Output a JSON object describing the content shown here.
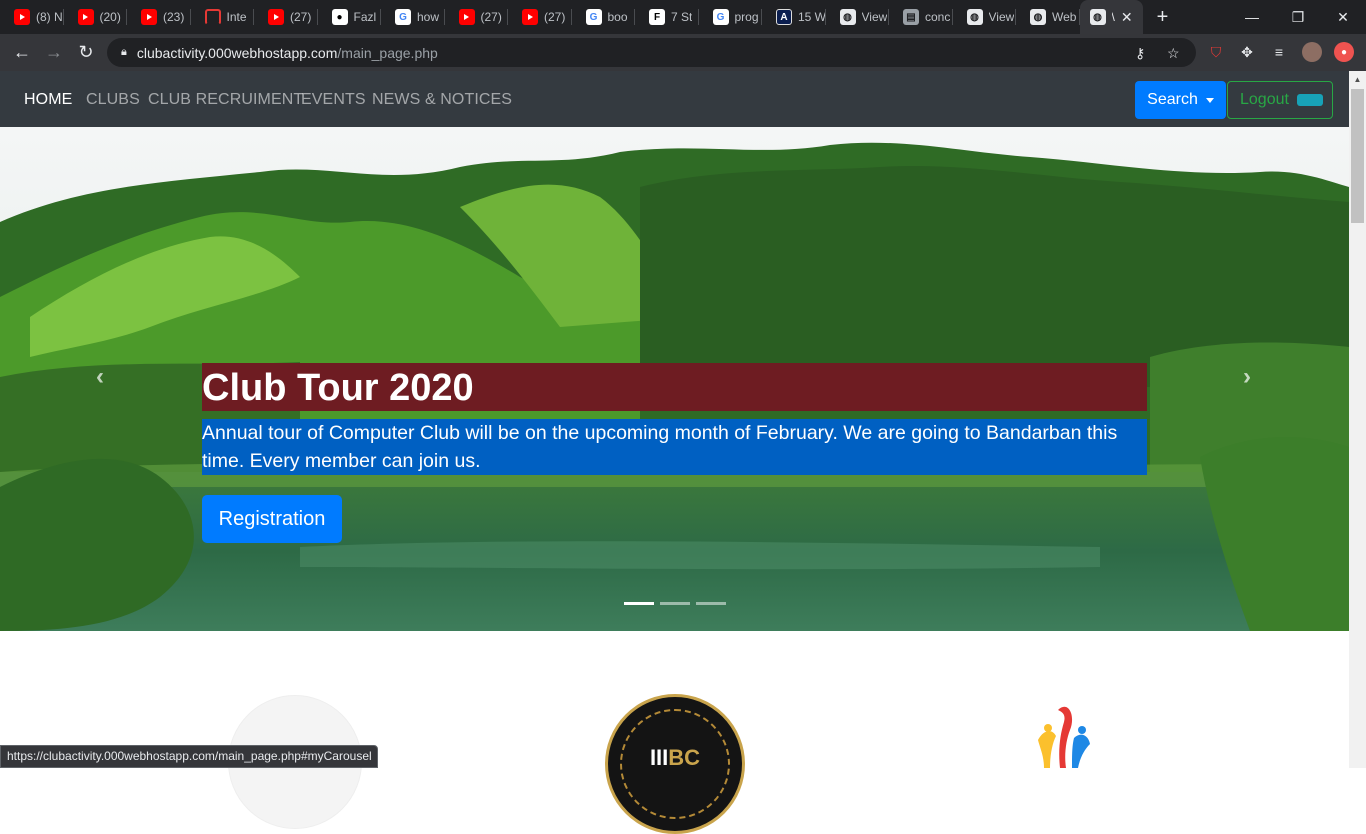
{
  "browser": {
    "tabs": [
      {
        "icon": "youtube-icon",
        "title": "(8) N"
      },
      {
        "icon": "youtube-icon",
        "title": "(20)"
      },
      {
        "icon": "youtube-icon",
        "title": "(23)"
      },
      {
        "icon": "internet-icon",
        "title": "Inte"
      },
      {
        "icon": "youtube-icon",
        "title": "(27)"
      },
      {
        "icon": "github-icon",
        "title": "Fazl"
      },
      {
        "icon": "google-icon",
        "title": "how"
      },
      {
        "icon": "youtube-icon",
        "title": "(27)"
      },
      {
        "icon": "youtube-icon",
        "title": "(27)"
      },
      {
        "icon": "google-icon",
        "title": "boo"
      },
      {
        "icon": "f-icon",
        "title": "7 St"
      },
      {
        "icon": "google-icon",
        "title": "prog"
      },
      {
        "icon": "angular-icon",
        "title": "15 W"
      },
      {
        "icon": "globe-icon",
        "title": "View"
      },
      {
        "icon": "document-icon",
        "title": "conc"
      },
      {
        "icon": "globe-icon",
        "title": "View"
      },
      {
        "icon": "globe-icon",
        "title": "Web"
      }
    ],
    "active_tab": {
      "icon": "globe-icon",
      "title": "\\"
    },
    "new_tab": "+",
    "window_controls": {
      "minimize": "—",
      "restore": "❐",
      "close": "✕"
    },
    "url_host": "clubactivity.000webhostapp.com",
    "url_path": "/main_page.php",
    "status_url": "https://clubactivity.000webhostapp.com/main_page.php#myCarousel"
  },
  "site": {
    "nav": [
      "HOME",
      "CLUBS",
      "CLUB RECRUIMENT",
      "EVENTS",
      "NEWS & NOTICES"
    ],
    "search_label": "Search",
    "logout_label": "Logout"
  },
  "carousel": {
    "title": "Club Tour 2020",
    "text": "Annual tour of Computer Club will be on the upcoming month of February. We are going to Bandarban this time. Every member can join us.",
    "button": "Registration",
    "slides": 3,
    "active_slide": 1
  },
  "logos": {
    "center_mark_left": "III",
    "center_mark_right": "BC"
  },
  "colors": {
    "navbar": "#343a40",
    "primary": "#007bff",
    "success": "#28a745",
    "caption_title_bg": "#6e1c22",
    "caption_text_bg": "#0060c2"
  }
}
